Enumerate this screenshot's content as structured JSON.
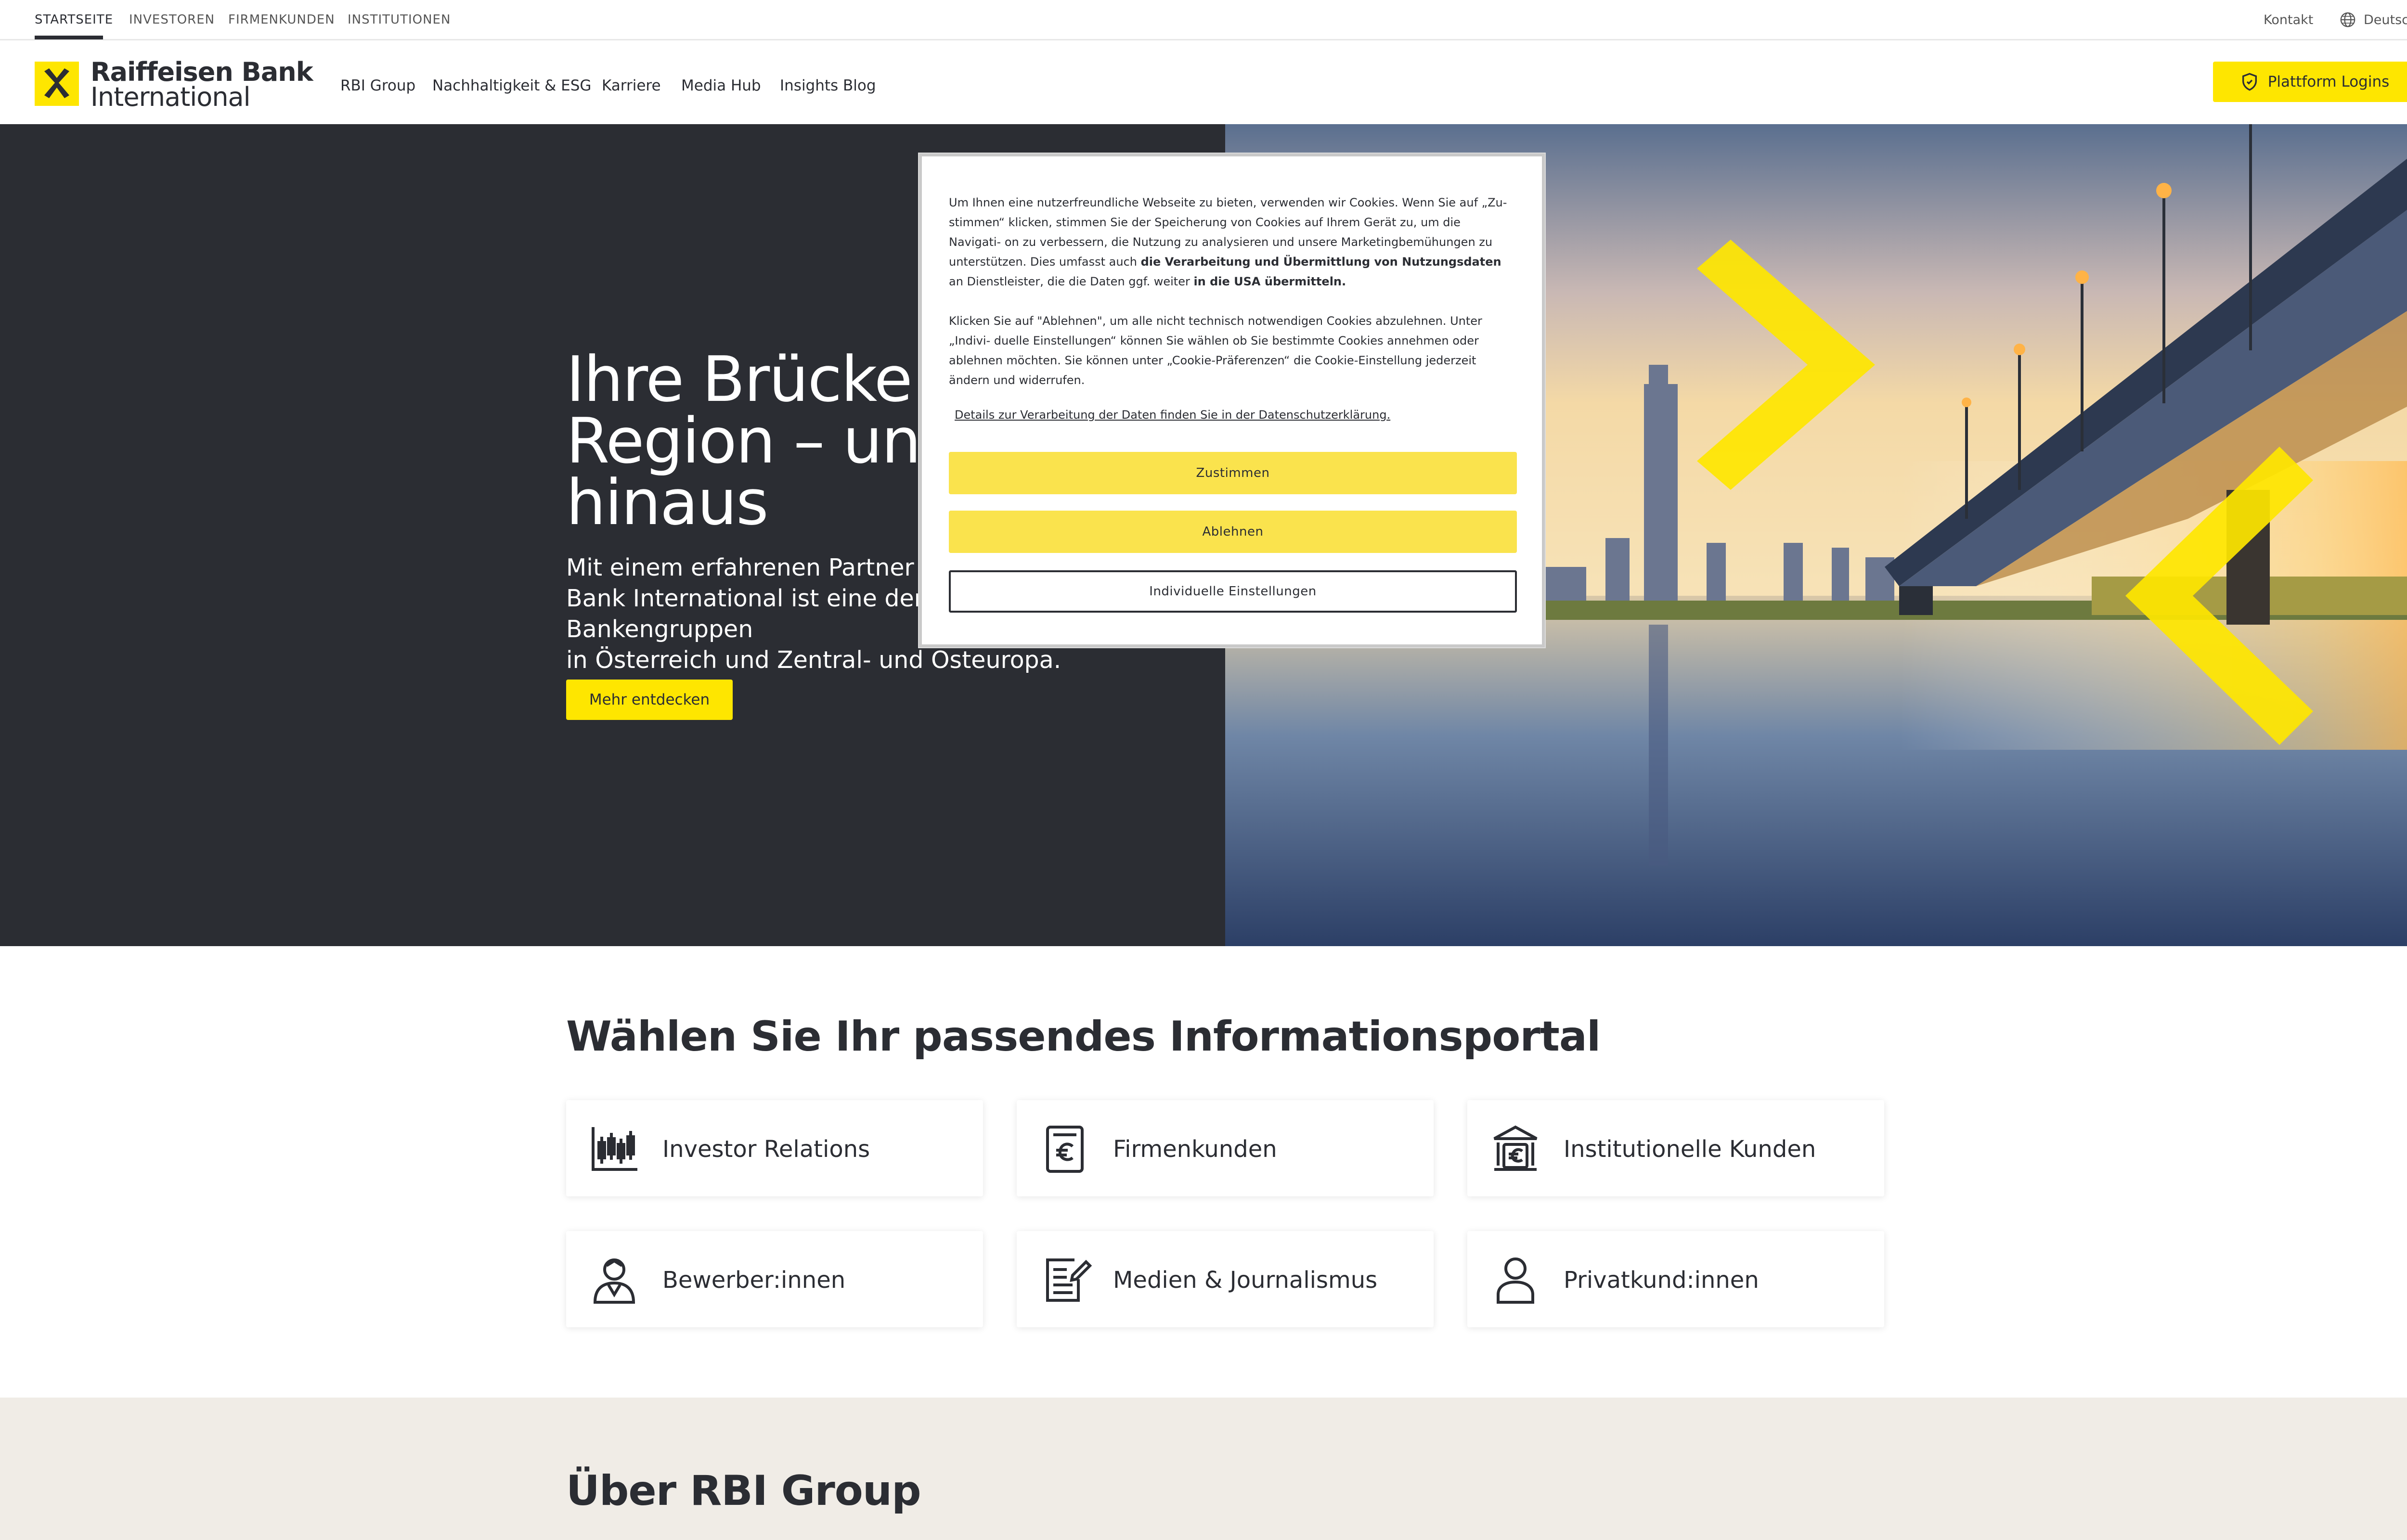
{
  "topbar": {
    "tabs": [
      "STARTSEITE",
      "INVESTOREN",
      "FIRMENKUNDEN",
      "INSTITUTIONEN"
    ],
    "contact": "Kontakt",
    "language": "Deutsch"
  },
  "header": {
    "logo_line1": "Raiffeisen Bank",
    "logo_line2": "International",
    "nav": [
      "RBI Group",
      "Nachhaltigkeit & ESG",
      "Karriere",
      "Media Hub",
      "Insights Blog"
    ],
    "login_label": "Plattform Logins"
  },
  "hero": {
    "title": "Ihre Brücke in die\nRegion – und darüber\nhinaus",
    "text": "Mit einem erfahrenen Partner weiterkommen: Raiffeisen\nBank International ist eine der führenden Bankengruppen\nin Österreich und Zentral- und Osteuropa.",
    "button": "Mehr entdecken"
  },
  "cookie": {
    "p1_a": "Um Ihnen eine nutzerfreundliche Webseite zu bieten, verwenden wir Cookies. Wenn Sie auf „Zu- stimmen“ klicken, stimmen Sie der Speicherung von Cookies auf Ihrem Gerät zu, um die Navigati- on zu verbessern, die Nutzung zu analysieren und unsere Marketingbemühungen zu unterstützen. Dies umfasst auch ",
    "p1_b": "die Verarbeitung und Übermittlung von Nutzungsdaten",
    "p1_c": " an Dienstleister, die die Daten ggf. weiter ",
    "p1_d": "in die USA übermitteln.",
    "p2": "Klicken Sie auf \"Ablehnen\", um alle nicht technisch notwendigen Cookies abzulehnen. Unter „Indivi- duelle Einstellungen“ können Sie wählen ob Sie bestimmte Cookies annehmen oder ablehnen möchten. Sie können unter „Cookie-Präferenzen“ die Cookie-Einstellung jederzeit ändern und widerrufen.",
    "details_link": "Details zur Verarbeitung der Daten finden Sie in der Datenschutzerklärung.",
    "accept": "Zustimmen",
    "reject": "Ablehnen",
    "settings": "Individuelle Einstellungen"
  },
  "portal": {
    "title": "Wählen Sie Ihr passendes Informationsportal",
    "cards": [
      {
        "label": "Investor Relations",
        "icon": "candlestick-chart-icon"
      },
      {
        "label": "Firmenkunden",
        "icon": "euro-document-icon"
      },
      {
        "label": "Institutionelle Kunden",
        "icon": "bank-building-euro-icon"
      },
      {
        "label": "Bewerber:innen",
        "icon": "applicant-person-icon"
      },
      {
        "label": "Medien & Journalismus",
        "icon": "edit-document-icon"
      },
      {
        "label": "Privatkund:innen",
        "icon": "person-icon"
      }
    ]
  },
  "about": {
    "title": "Über RBI Group"
  },
  "colors": {
    "brand_yellow": "#fee600",
    "dark": "#2b2d33",
    "about_bg": "#f0ece6"
  }
}
